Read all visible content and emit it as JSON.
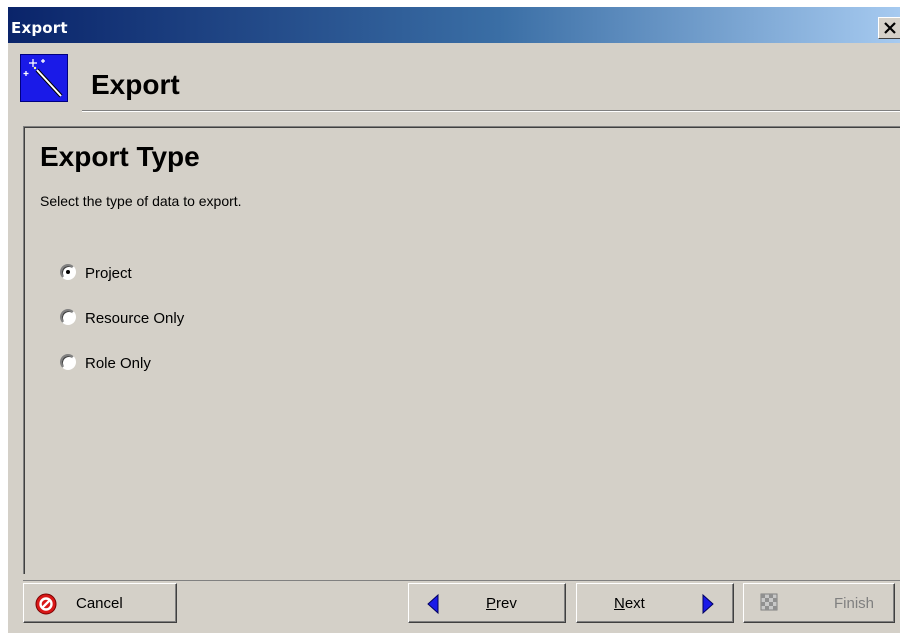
{
  "window": {
    "title": "Export"
  },
  "header": {
    "title": "Export",
    "icon": "magic-wand-icon"
  },
  "page": {
    "title": "Export Type",
    "description": "Select the type of data to export."
  },
  "export_type": {
    "options": [
      {
        "label": "Project",
        "checked": true
      },
      {
        "label": "Resource Only",
        "checked": false
      },
      {
        "label": "Role Only",
        "checked": false
      }
    ]
  },
  "buttons": {
    "cancel": {
      "label": "Cancel",
      "icon": "cancel-icon"
    },
    "prev": {
      "underline": "P",
      "rest": "rev",
      "icon": "left-arrow-icon"
    },
    "next": {
      "underline": "N",
      "rest": "ext",
      "icon": "right-arrow-icon"
    },
    "finish": {
      "label": "Finish",
      "icon": "finish-flag-icon",
      "enabled": false
    }
  },
  "colors": {
    "titlebar_start": "#0a246a",
    "titlebar_end": "#a6caf0",
    "dialog_face": "#d4d0c8",
    "header_icon_bg": "#1a1ae8",
    "arrow_blue": "#1a1ae8",
    "cancel_red": "#d81818"
  }
}
